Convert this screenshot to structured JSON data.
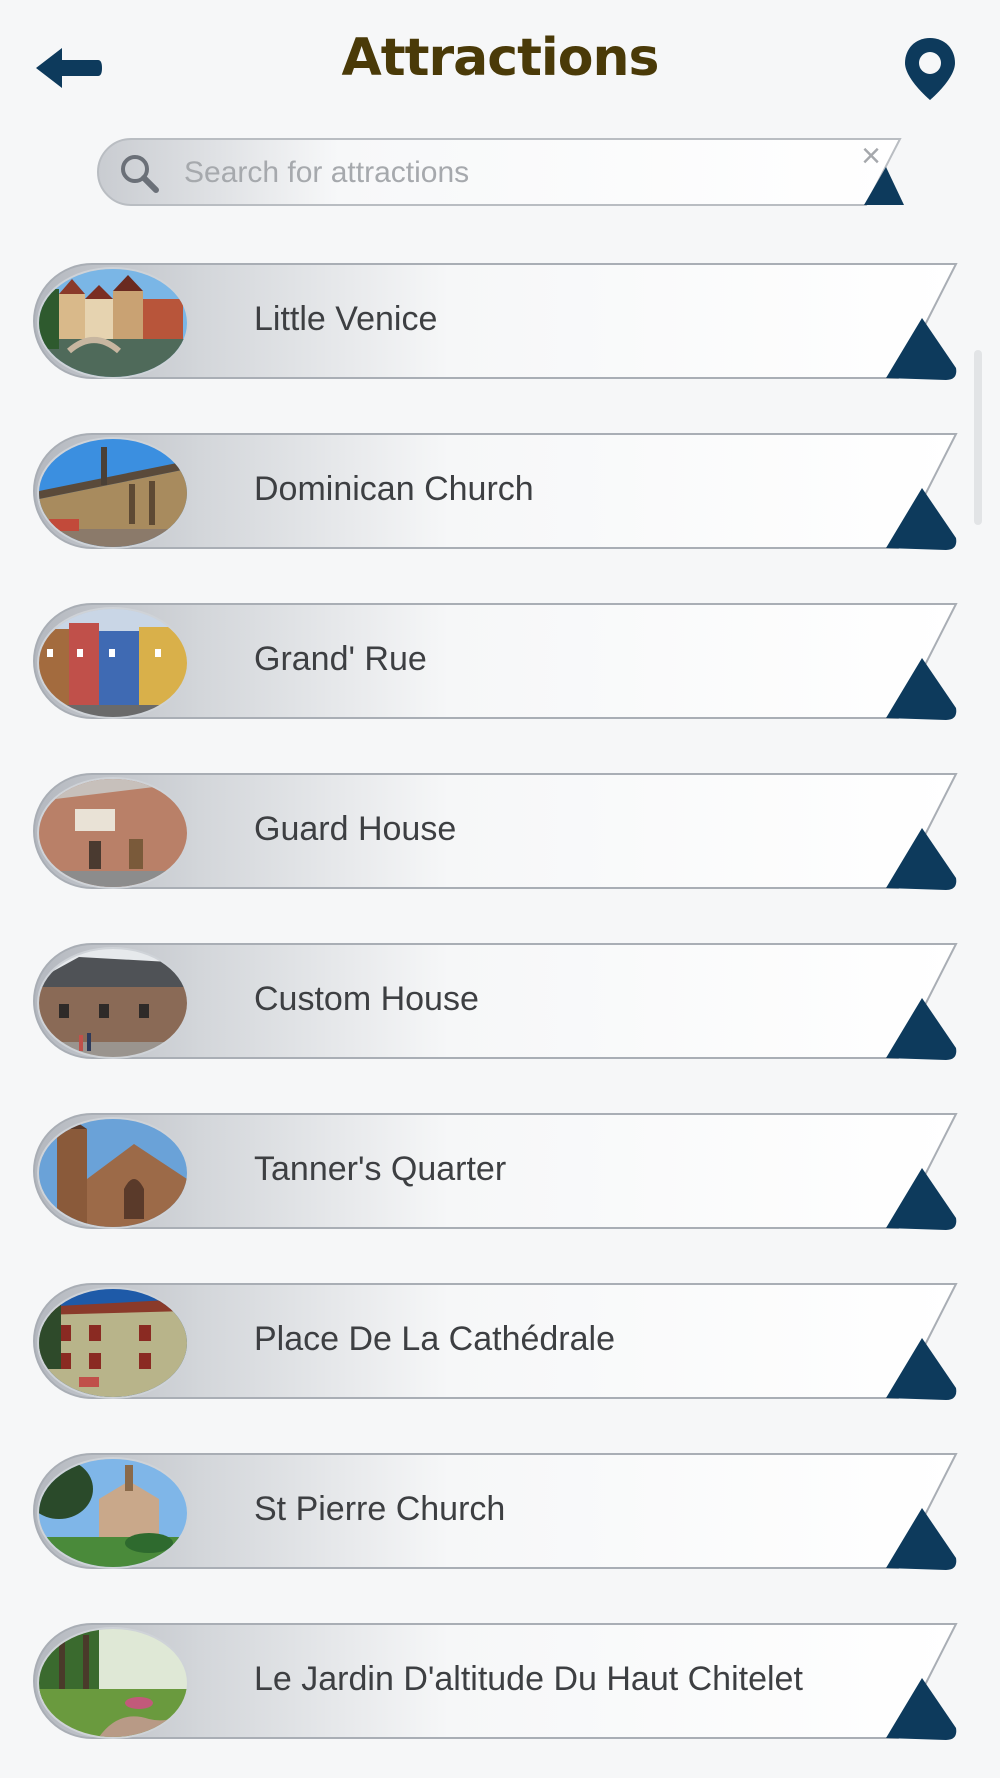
{
  "header": {
    "title": "Attractions",
    "back_icon": "arrow-left-icon",
    "map_icon": "map-pin-icon",
    "accent_color": "#0d3a5c",
    "title_color": "#4a3a08"
  },
  "search": {
    "placeholder": "Search for attractions",
    "value": "",
    "icon": "search-icon",
    "clear_label": "×"
  },
  "attractions": [
    {
      "label": "Little Venice",
      "thumb": "canal-houses-photo"
    },
    {
      "label": "Dominican Church",
      "thumb": "gothic-church-photo"
    },
    {
      "label": "Grand' Rue",
      "thumb": "colorful-houses-photo"
    },
    {
      "label": "Guard House",
      "thumb": "stone-building-photo"
    },
    {
      "label": "Custom House",
      "thumb": "old-hall-photo"
    },
    {
      "label": "Tanner's Quarter",
      "thumb": "cathedral-photo"
    },
    {
      "label": "Place De La Cathédrale",
      "thumb": "square-building-photo"
    },
    {
      "label": "St Pierre Church",
      "thumb": "church-garden-photo"
    },
    {
      "label": "Le Jardin D'altitude Du Haut Chitelet",
      "thumb": "alpine-garden-photo"
    }
  ]
}
